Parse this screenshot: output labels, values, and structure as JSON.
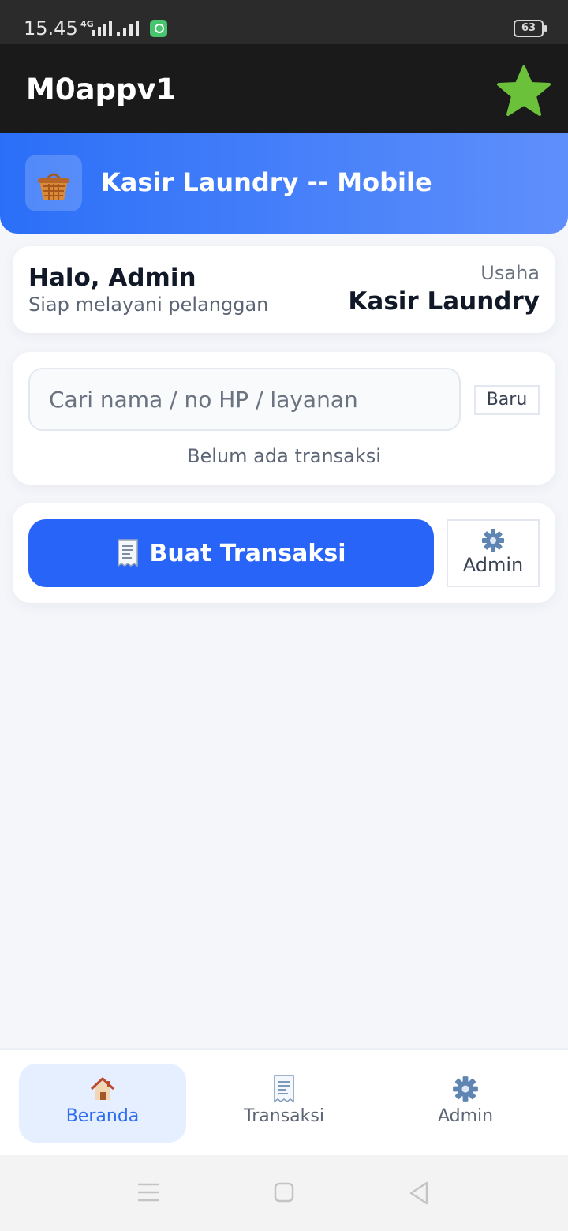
{
  "status_bar": {
    "time": "15.45",
    "network": "4G",
    "battery": "63"
  },
  "app_bar": {
    "title": "M0appv1",
    "favorite_icon": "star-icon"
  },
  "hero": {
    "icon": "basket-icon",
    "title": "Kasir Laundry -- Mobile"
  },
  "greeting": {
    "title": "Halo, Admin",
    "subtitle": "Siap melayani pelanggan",
    "business_label": "Usaha",
    "business_name": "Kasir Laundry"
  },
  "search": {
    "placeholder": "Cari nama / no HP / layanan",
    "new_button": "Baru",
    "empty_text": "Belum ada transaksi"
  },
  "actions": {
    "primary_label": "Buat Transaksi",
    "primary_icon": "receipt-icon",
    "admin_label": "Admin",
    "admin_icon": "gear-icon"
  },
  "bottom_nav": {
    "items": [
      {
        "label": "Beranda",
        "icon": "home-icon",
        "active": true
      },
      {
        "label": "Transaksi",
        "icon": "receipt-icon",
        "active": false
      },
      {
        "label": "Admin",
        "icon": "gear-icon",
        "active": false
      }
    ]
  },
  "colors": {
    "primary": "#2864f8",
    "app_bar": "#1a1a1a",
    "star": "#6cc13b"
  }
}
